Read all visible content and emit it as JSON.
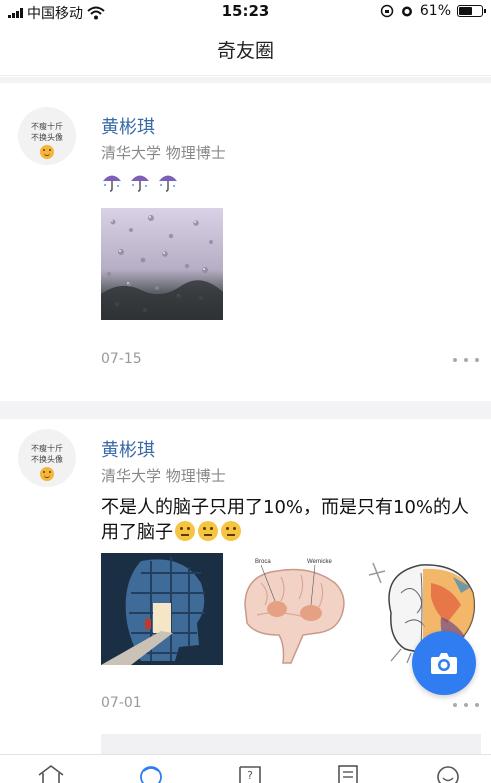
{
  "status_bar": {
    "carrier": "中国移动",
    "time": "15:23",
    "battery": "61%",
    "battery_level": 0.61
  },
  "header": {
    "title": "奇友圈"
  },
  "posts": [
    {
      "avatar_text": [
        "不瘦十斤",
        "不换头像"
      ],
      "name": "黄彬琪",
      "subtitle": "清华大学 物理博士",
      "content_icons": [
        "umbrella-rain-icon",
        "umbrella-rain-icon",
        "umbrella-rain-icon"
      ],
      "images": [
        "rain-window-photo"
      ],
      "date": "07-15"
    },
    {
      "avatar_text": [
        "不瘦十斤",
        "不换头像"
      ],
      "name": "黄彬琪",
      "subtitle": "清华大学 物理博士",
      "text": "不是人的脑子只用了10%，而是只有10%的人用了脑子",
      "emojis": [
        "neutral-face-icon",
        "neutral-face-icon",
        "neutral-face-icon"
      ],
      "images": [
        "head-door-illustration",
        "brain-broca-wernicke-diagram",
        "colorful-brain-illustration"
      ],
      "brain_labels": [
        "Broca",
        "Wernicke"
      ],
      "date": "07-01"
    }
  ],
  "tab_bar": {
    "icons": [
      "home-icon",
      "discover-icon",
      "question-icon",
      "document-icon",
      "profile-icon"
    ]
  },
  "colors": {
    "accent": "#2f7df1",
    "name_link": "#3a6aa8",
    "muted": "#999999",
    "divider": "#f3f3f5"
  }
}
